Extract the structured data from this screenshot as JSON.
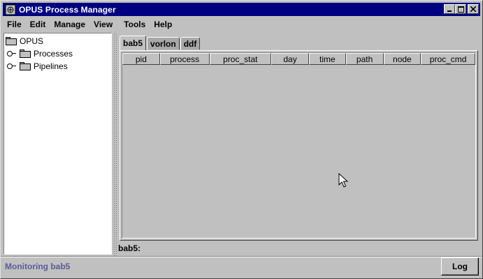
{
  "window": {
    "title": "OPUS Process Manager"
  },
  "menu": [
    "File",
    "Edit",
    "Manage",
    "View",
    "Tools",
    "Help"
  ],
  "tree": {
    "root": "OPUS",
    "children": [
      "Processes",
      "Pipelines"
    ]
  },
  "tabs": [
    {
      "label": "bab5",
      "active": true
    },
    {
      "label": "vorlon",
      "active": false
    },
    {
      "label": "ddf",
      "active": false
    }
  ],
  "table": {
    "columns": [
      "pid",
      "process",
      "proc_stat",
      "day",
      "time",
      "path",
      "node",
      "proc_cmd"
    ],
    "rows": []
  },
  "panel_status": "bab5:",
  "status": {
    "text": "Monitoring bab5",
    "log_button": "Log"
  }
}
